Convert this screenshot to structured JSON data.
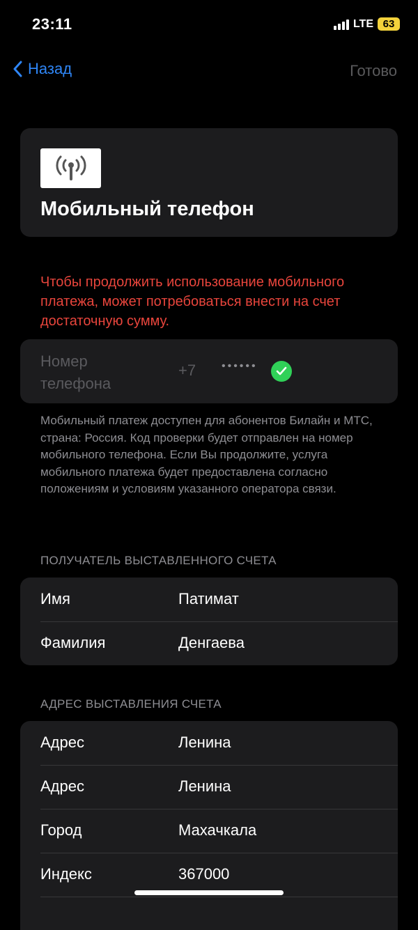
{
  "status_bar": {
    "time": "23:11",
    "network": "LTE",
    "battery": "63"
  },
  "nav": {
    "back_label": "Назад",
    "done_label": "Готово"
  },
  "header": {
    "icon": "antenna-icon",
    "title": "Мобильный телефон"
  },
  "warning_text": "Чтобы продолжить использование мобильного платежа, может потребоваться внести на счет достаточную сумму.",
  "phone": {
    "label": "Номер телефона",
    "prefix": "+7",
    "masked": "••••••",
    "verified_icon": "checkmark-circle-icon"
  },
  "info_text": "Мобильный платеж доступен для абонентов Билайн и МТС, страна: Россия. Код проверки будет отправлен на номер мобильного телефона. Если Вы продолжите, услуга мобильного платежа будет предоставлена согласно положениям и условиям указанного оператора связи.",
  "recipient": {
    "section_title": "ПОЛУЧАТЕЛЬ ВЫСТАВЛЕННОГО СЧЕТА",
    "rows": [
      {
        "label": "Имя",
        "value": "Патимат"
      },
      {
        "label": "Фамилия",
        "value": "Денгаева"
      }
    ]
  },
  "address": {
    "section_title": "АДРЕС ВЫСТАВЛЕНИЯ СЧЕТА",
    "rows": [
      {
        "label": "Адрес",
        "value": "Ленина"
      },
      {
        "label": "Адрес",
        "value": "Ленина"
      },
      {
        "label": "Город",
        "value": "Махачкала"
      },
      {
        "label": "Индекс",
        "value": "367000"
      }
    ]
  },
  "colors": {
    "accent": "#2f86f6",
    "warning": "#e8453c",
    "success": "#30d158",
    "battery": "#f3d23b"
  }
}
